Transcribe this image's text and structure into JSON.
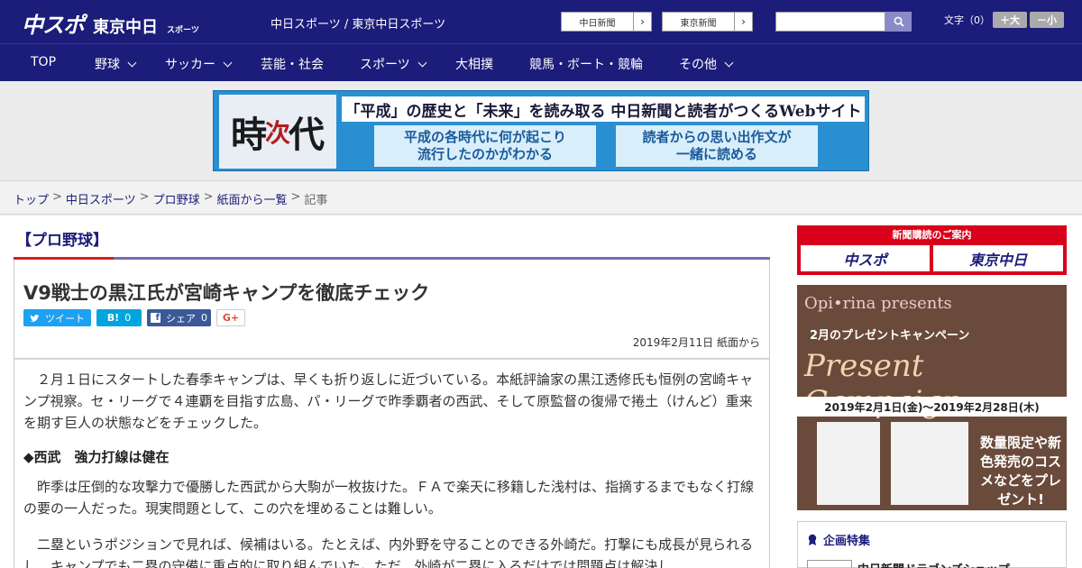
{
  "header": {
    "logo_main": "中スポ",
    "logo_sub": "東京中日",
    "logo_sub2": "スポーツ",
    "site_name": "中日スポーツ / 東京中日スポーツ",
    "ext_links": [
      {
        "label": "中日新聞",
        "arrow": "›"
      },
      {
        "label": "東京新聞",
        "arrow": "›"
      }
    ],
    "search_placeholder": "",
    "font_label": "文字（0）",
    "font_bigger": "＋大",
    "font_smaller": "－小"
  },
  "nav": {
    "items": [
      {
        "label": "TOP"
      },
      {
        "label": "野球"
      },
      {
        "label": "サッカー"
      },
      {
        "label": "芸能・社会"
      },
      {
        "label": "スポーツ"
      },
      {
        "label": "大相撲"
      },
      {
        "label": "競馬・ボート・競輪"
      },
      {
        "label": "その他"
      }
    ]
  },
  "banner": {
    "logo_char1": "時",
    "logo_char2": "次",
    "logo_char3": "代",
    "headline": "「平成」の歴史と「未来」を読み取る 中日新聞と読者がつくるWebサイト",
    "left_line1": "平成の各時代に何が起こり",
    "left_line2": "流行したのかがわかる",
    "right_line1": "読者からの思い出作文が",
    "right_line2": "一緒に読める"
  },
  "breadcrumb": {
    "items": [
      "トップ",
      "中日スポーツ",
      "プロ野球",
      "紙面から一覧"
    ],
    "separator": ">",
    "current": "記事"
  },
  "article": {
    "category": "【プロ野球】",
    "title": "V9戦士の黒江氏が宮崎キャンプを徹底チェック",
    "share": {
      "tweet": "ツイート",
      "hatena_icon": "B!",
      "hatena_count": "0",
      "facebook_label": "シェア",
      "facebook_count": "0",
      "gplus": "G+"
    },
    "date": "2019年2月11日 紙面から",
    "para1": "　２月１日にスタートした春季キャンプは、早くも折り返しに近づいている。本紙評論家の黒江透修氏も恒例の宮崎キャンプ視察。セ・リーグで４連覇を目指す広島、パ・リーグで昨季覇者の西武、そして原監督の復帰で捲土（けんど）重来を期す巨人の状態などをチェックした。",
    "subhead": "◆西武　強力打線は健在",
    "para2": "　昨季は圧倒的な攻撃力で優勝した西武から大駒が一枚抜けた。ＦＡで楽天に移籍した浅村は、指摘するまでもなく打線の要の一人だった。現実問題として、この穴を埋めることは難しい。",
    "para3": "　二塁というポジションで見れば、候補はいる。たとえば、内外野を守ることのできる外崎だ。打撃にも成長が見られるし、キャンプでも二塁の守備に重点的に取り組んでいた。ただ、外崎が二塁に入るだけでは問題点は解決し"
  },
  "sidebar": {
    "subscribe_header": "新聞購読のご案内",
    "subscribe_left": "中スポ",
    "subscribe_right": "東京中日",
    "ad_brand": "Opi•rina presents",
    "ad_campaign": "2月のプレゼントキャンペーン",
    "ad_title": "Present Campaign",
    "ad_period": "2019年2月1日(金)～2019年2月28日(木)",
    "ad_promo": "数量限定や新色発売のコスメなどをプレゼント!",
    "feature_header": "企画特集",
    "feature_item": "中日新聞ドラゴンズショップ"
  },
  "colors": {
    "brand_navy": "#1c1c7a",
    "accent_red": "#d12020",
    "accent_purple": "#7a6ab0",
    "twitter": "#1da1f2",
    "hatena": "#00a4de",
    "facebook": "#3b5998"
  }
}
